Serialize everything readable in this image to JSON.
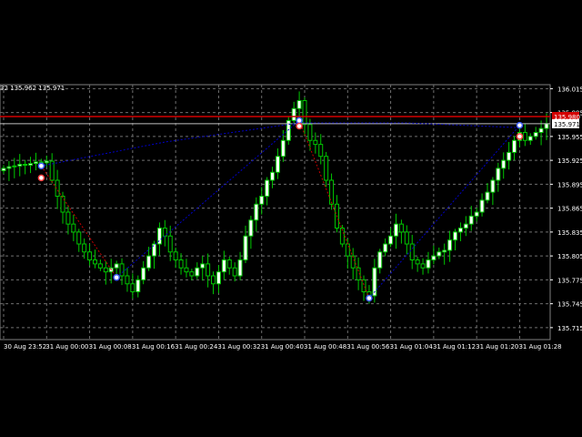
{
  "header": {
    "ohlc_text": "32 135.962 135.971"
  },
  "price_labels": {
    "red_line": "135.980",
    "current": "135.971"
  },
  "colors": {
    "background": "#000000",
    "grid": "#6f6f6f",
    "axis_text": "#ffffff",
    "bull_candle": "#00c800",
    "bull_body": "#ffffff",
    "bear_body": "#000000",
    "red_line": "#d40000",
    "white_line": "#c0c0c0",
    "zigzag_blue": "#0000c8",
    "zigzag_red": "#c80000",
    "marker_blue": "#4060ff",
    "marker_red": "#ff4040"
  },
  "chart_data": {
    "type": "candlestick",
    "title": "",
    "xlabel": "",
    "ylabel": "",
    "ylim": [
      135.7,
      136.02
    ],
    "y_ticks": [
      "136.015",
      "135.985",
      "135.955",
      "135.925",
      "135.895",
      "135.865",
      "135.835",
      "135.805",
      "135.775",
      "135.745",
      "135.715"
    ],
    "y_tick_values": [
      136.015,
      135.985,
      135.955,
      135.925,
      135.895,
      135.865,
      135.835,
      135.805,
      135.775,
      135.745,
      135.715
    ],
    "x_ticks": [
      "30 Aug 23:52",
      "31 Aug 00:00",
      "31 Aug 00:08",
      "31 Aug 00:16",
      "31 Aug 00:24",
      "31 Aug 00:32",
      "31 Aug 00:40",
      "31 Aug 00:48",
      "31 Aug 00:56",
      "31 Aug 01:04",
      "31 Aug 01:12",
      "31 Aug 01:20",
      "31 Aug 01:28"
    ],
    "x_tick_index": [
      0,
      8,
      16,
      24,
      32,
      40,
      48,
      56,
      64,
      72,
      80,
      88,
      96
    ],
    "red_line_price": 135.98,
    "current_price": 135.971,
    "closes": [
      135.915,
      135.917,
      135.918,
      135.92,
      135.919,
      135.921,
      135.923,
      135.922,
      135.924,
      135.9,
      135.88,
      135.86,
      135.845,
      135.835,
      135.82,
      135.81,
      135.8,
      135.795,
      135.79,
      135.785,
      135.79,
      135.795,
      135.78,
      135.77,
      135.76,
      135.775,
      135.79,
      135.805,
      135.82,
      135.84,
      135.83,
      135.81,
      135.8,
      135.79,
      135.785,
      135.78,
      135.79,
      135.795,
      135.78,
      135.77,
      135.785,
      135.8,
      135.79,
      135.78,
      135.8,
      135.83,
      135.85,
      135.87,
      135.88,
      135.9,
      135.91,
      135.93,
      135.95,
      135.975,
      135.99,
      136.0,
      135.97,
      135.95,
      135.945,
      135.93,
      135.9,
      135.87,
      135.84,
      135.82,
      135.805,
      135.79,
      135.775,
      135.76,
      135.755,
      135.79,
      135.81,
      135.82,
      135.83,
      135.845,
      135.835,
      135.82,
      135.8,
      135.795,
      135.79,
      135.8,
      135.805,
      135.81,
      135.812,
      135.825,
      135.835,
      135.84,
      135.845,
      135.855,
      135.86,
      135.875,
      135.885,
      135.9,
      135.915,
      135.925,
      135.935,
      135.95,
      135.96,
      135.95,
      135.955,
      135.96,
      135.965,
      135.971
    ],
    "zigzag_points": [
      {
        "index": 7,
        "price": 135.918
      },
      {
        "index": 21,
        "price": 135.778
      },
      {
        "index": 55,
        "price": 135.975
      },
      {
        "index": 68,
        "price": 135.752
      },
      {
        "index": 96,
        "price": 135.969
      }
    ],
    "pivot_red_points": [
      {
        "index": 7,
        "price": 135.903
      },
      {
        "index": 55,
        "price": 135.968
      },
      {
        "index": 96,
        "price": 135.955
      }
    ],
    "blue_curve": [
      {
        "index": 7,
        "price": 135.918
      },
      {
        "index": 30,
        "price": 135.948
      },
      {
        "index": 55,
        "price": 135.972
      },
      {
        "index": 75,
        "price": 135.972
      },
      {
        "index": 96,
        "price": 135.966
      }
    ]
  }
}
